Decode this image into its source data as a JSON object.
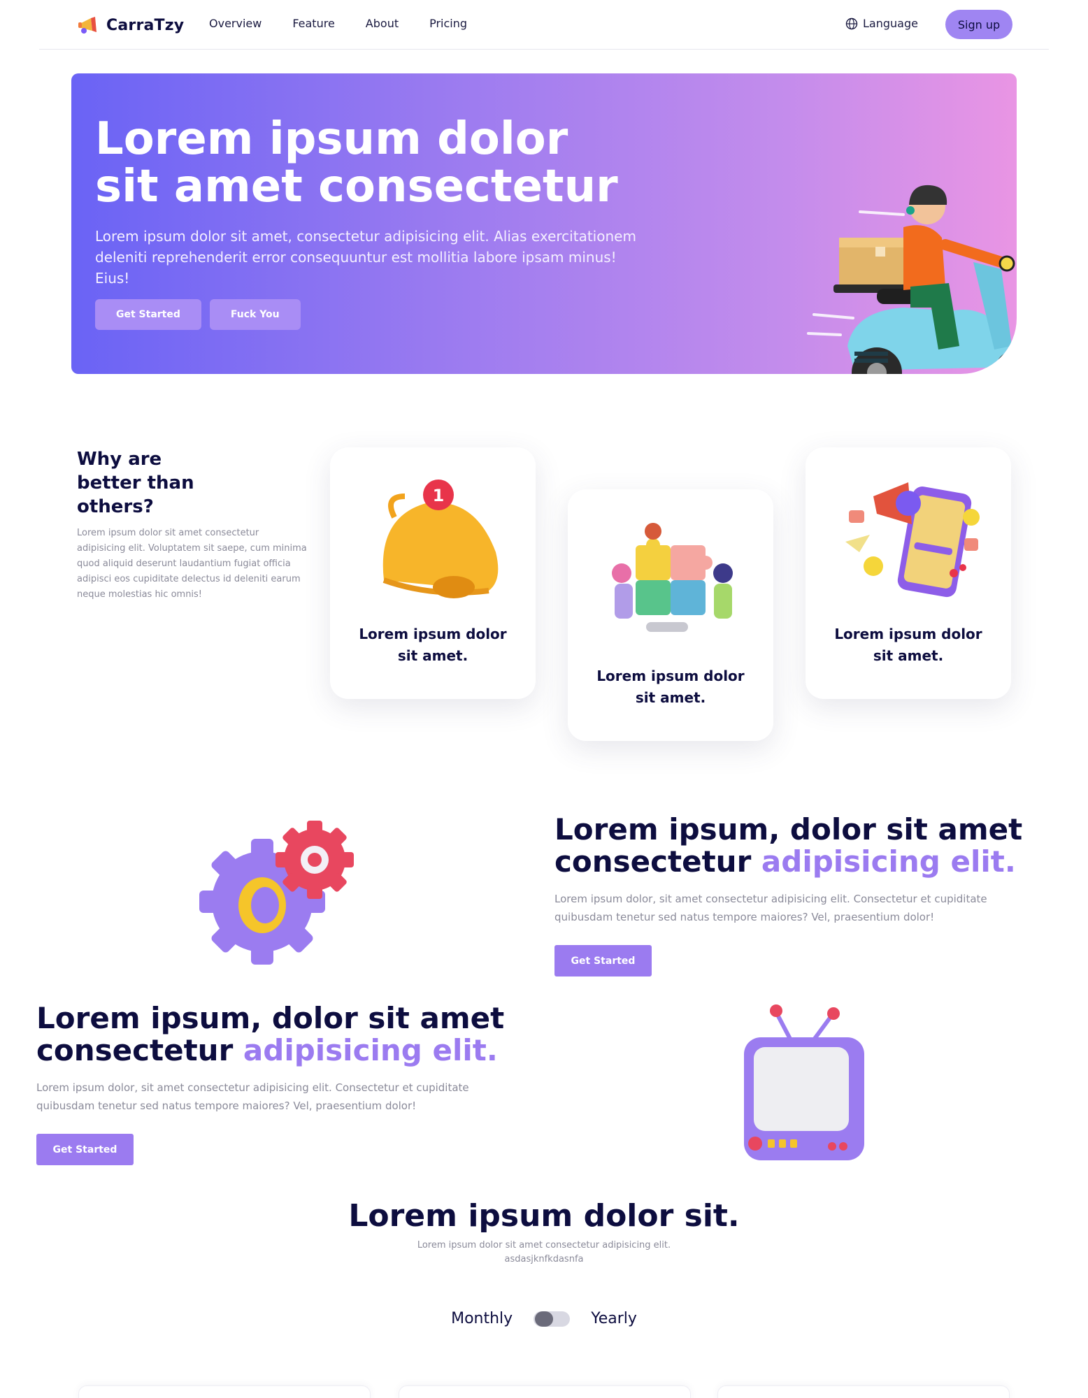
{
  "nav": {
    "brand": "CarraTzy",
    "links": [
      "Overview",
      "Feature",
      "About",
      "Pricing"
    ],
    "language": "Language",
    "signup": "Sign up"
  },
  "hero": {
    "title": "Lorem ipsum dolor sit amet consectetur",
    "subtitle": "Lorem ipsum dolor sit amet, consectetur adipisicing elit. Alias exercitationem deleniti reprehenderit error consequuntur est mollitia labore ipsam minus! Eius!",
    "buttons": [
      "Get Started",
      "Fuck You"
    ]
  },
  "why": {
    "title": "Why are better than others?",
    "text": "Lorem ipsum dolor sit amet consectetur adipisicing elit. Voluptatem sit saepe, cum minima quod aliquid deserunt laudantium fugiat officia adipisci eos cupiditate delectus id deleniti earum neque molestias hic omnis!",
    "cards": [
      {
        "label": "Lorem ipsum dolor sit amet.",
        "icon": "bell-icon",
        "badge": "1"
      },
      {
        "label": "Lorem ipsum dolor sit amet.",
        "icon": "puzzle-team-icon"
      },
      {
        "label": "Lorem ipsum dolor sit amet.",
        "icon": "phone-megaphone-icon"
      }
    ]
  },
  "features": [
    {
      "title_main": "Lorem ipsum, dolor sit amet consectetur ",
      "title_accent": "adipisicing elit.",
      "text": "Lorem ipsum dolor, sit amet consectetur adipisicing elit. Consectetur et cupiditate quibusdam tenetur sed natus tempore maiores? Vel, praesentium dolor!",
      "button": "Get Started",
      "illustration": "gears-icon"
    },
    {
      "title_main": "Lorem ipsum, dolor sit amet consectetur ",
      "title_accent": "adipisicing elit.",
      "text": "Lorem ipsum dolor, sit amet consectetur adipisicing elit. Consectetur et cupiditate quibusdam tenetur sed natus tempore maiores? Vel, praesentium dolor!",
      "button": "Get Started",
      "illustration": "tv-icon"
    }
  ],
  "pricing": {
    "title": "Lorem ipsum dolor sit.",
    "subtitle_line1": "Lorem ipsum dolor sit amet consectetur adipisicing elit.",
    "subtitle_line2": "asdasjknfkdasnfa",
    "toggle_left": "Monthly",
    "toggle_right": "Yearly",
    "toggle_state": "monthly"
  },
  "colors": {
    "accent": "#9b7bf0",
    "navy": "#0d0d3f",
    "hero_gradient_start": "#6a63f5",
    "hero_gradient_end": "#e995e4"
  }
}
